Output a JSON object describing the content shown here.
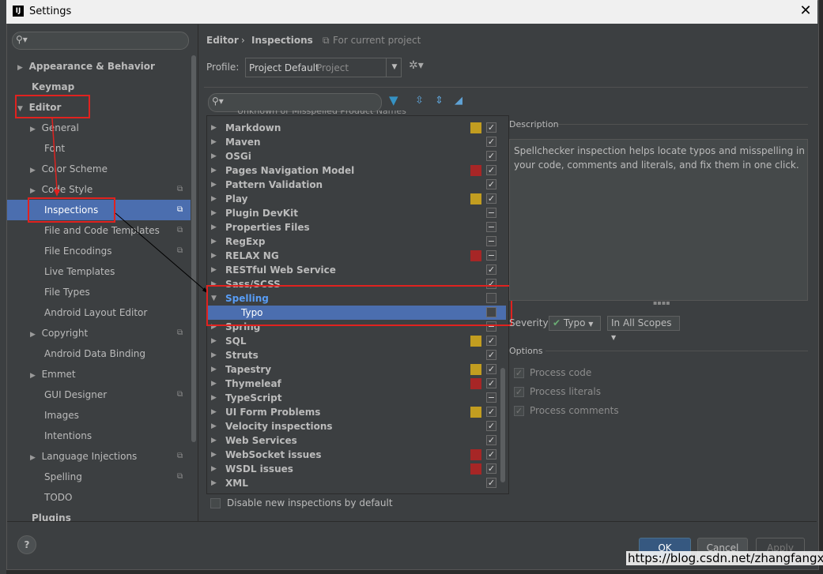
{
  "window": {
    "title": "Settings",
    "logo_text": "IJ"
  },
  "sidebar": {
    "items": [
      {
        "label": "Appearance & Behavior"
      },
      {
        "label": "Keymap"
      },
      {
        "label": "Editor"
      },
      {
        "label": "General"
      },
      {
        "label": "Font"
      },
      {
        "label": "Color Scheme"
      },
      {
        "label": "Code Style"
      },
      {
        "label": "Inspections"
      },
      {
        "label": "File and Code Templates"
      },
      {
        "label": "File Encodings"
      },
      {
        "label": "Live Templates"
      },
      {
        "label": "File Types"
      },
      {
        "label": "Android Layout Editor"
      },
      {
        "label": "Copyright"
      },
      {
        "label": "Android Data Binding"
      },
      {
        "label": "Emmet"
      },
      {
        "label": "GUI Designer"
      },
      {
        "label": "Images"
      },
      {
        "label": "Intentions"
      },
      {
        "label": "Language Injections"
      },
      {
        "label": "Spelling"
      },
      {
        "label": "TODO"
      },
      {
        "label": "Plugins"
      }
    ]
  },
  "breadcrumb": {
    "part1": "Editor",
    "separator": "›",
    "part2": "Inspections",
    "scope": "For current project"
  },
  "profile": {
    "label": "Profile:",
    "value": "Project Default",
    "suffix": "Project"
  },
  "inspections": {
    "partial_top": "Unknown or Misspelled Product Names",
    "rows": [
      {
        "name": "Markdown",
        "sev": "#c29d20",
        "check": "✓"
      },
      {
        "name": "Maven",
        "sev": "",
        "check": "✓"
      },
      {
        "name": "OSGi",
        "sev": "",
        "check": "✓"
      },
      {
        "name": "Pages Navigation Model",
        "sev": "#a72626",
        "check": "✓"
      },
      {
        "name": "Pattern Validation",
        "sev": "",
        "check": "✓"
      },
      {
        "name": "Play",
        "sev": "#c29d20",
        "check": "✓"
      },
      {
        "name": "Plugin DevKit",
        "sev": "",
        "check": "−"
      },
      {
        "name": "Properties Files",
        "sev": "",
        "check": "−"
      },
      {
        "name": "RegExp",
        "sev": "",
        "check": "−"
      },
      {
        "name": "RELAX NG",
        "sev": "#a72626",
        "check": "−"
      },
      {
        "name": "RESTful Web Service",
        "sev": "",
        "check": "✓"
      },
      {
        "name": "Sass/SCSS",
        "sev": "",
        "check": "✓"
      },
      {
        "name": "Spelling",
        "sev": "",
        "check": ""
      },
      {
        "name": "Typo",
        "sev": "",
        "check": ""
      },
      {
        "name": "Spring",
        "sev": "",
        "check": "−"
      },
      {
        "name": "SQL",
        "sev": "#c29d20",
        "check": "✓"
      },
      {
        "name": "Struts",
        "sev": "",
        "check": "✓"
      },
      {
        "name": "Tapestry",
        "sev": "#c29d20",
        "check": "✓"
      },
      {
        "name": "Thymeleaf",
        "sev": "#a72626",
        "check": "✓"
      },
      {
        "name": "TypeScript",
        "sev": "",
        "check": "−"
      },
      {
        "name": "UI Form Problems",
        "sev": "#c29d20",
        "check": "✓"
      },
      {
        "name": "Velocity inspections",
        "sev": "",
        "check": "✓"
      },
      {
        "name": "Web Services",
        "sev": "",
        "check": "✓"
      },
      {
        "name": "WebSocket issues",
        "sev": "#a72626",
        "check": "✓"
      },
      {
        "name": "WSDL issues",
        "sev": "#a72626",
        "check": "✓"
      },
      {
        "name": "XML",
        "sev": "",
        "check": "✓"
      }
    ],
    "disable_new": "Disable new inspections by default"
  },
  "description": {
    "header": "Description",
    "text": "Spellchecker inspection helps locate typos and misspelling in your code, comments and literals, and fix them in one click."
  },
  "severity": {
    "label": "Severity:",
    "value": "Typo",
    "scope": "In All Scopes"
  },
  "options": {
    "header": "Options",
    "items": [
      "Process code",
      "Process literals",
      "Process comments"
    ]
  },
  "buttons": {
    "ok": "OK",
    "cancel": "Cancel",
    "apply": "Apply",
    "help": "?"
  },
  "watermark": "https://blog.csdn.net/zhangfangxu"
}
